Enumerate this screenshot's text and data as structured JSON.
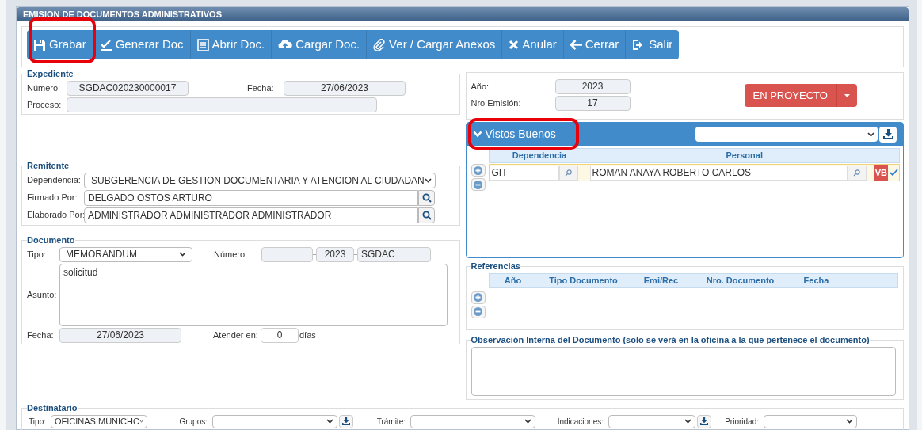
{
  "panel_title": "EMISION DE DOCUMENTOS ADMINISTRATIVOS",
  "toolbar": [
    {
      "label": "Grabar",
      "highlighted": true
    },
    {
      "label": "Generar Doc",
      "highlighted": false
    },
    {
      "label": "Abrir Doc.",
      "highlighted": false
    },
    {
      "label": "Cargar Doc.",
      "highlighted": false
    },
    {
      "label": "Ver / Cargar Anexos",
      "highlighted": false
    },
    {
      "label": "Anular",
      "highlighted": false
    },
    {
      "label": "Cerrar",
      "highlighted": false
    },
    {
      "label": "Salir",
      "highlighted": false
    }
  ],
  "expediente": {
    "legend": "Expediente",
    "numero_label": "Número:",
    "numero": "SGDAC020230000017",
    "fecha_label": "Fecha:",
    "fecha": "27/06/2023",
    "proceso_label": "Proceso:"
  },
  "emision": {
    "anio_label": "Año:",
    "anio": "2023",
    "nro_label": "Nro Emisión:",
    "nro": "17",
    "status": "EN PROYECTO"
  },
  "vistos_buenos": {
    "title": "Vistos Buenos",
    "highlighted": true,
    "columns": [
      "Dependencia",
      "Personal"
    ],
    "rows": [
      {
        "dependencia": "GIT",
        "personal": "ROMAN ANAYA ROBERTO CARLOS",
        "badge": "VB",
        "checked": true
      }
    ]
  },
  "remitente": {
    "legend": "Remitente",
    "fields": [
      {
        "label": "Dependencia:",
        "value": "SUBGERENCIA DE GESTION DOCUMENTARIA Y ATENCION AL CIUDADAN",
        "kind": "select"
      },
      {
        "label": "Firmado Por:",
        "value": "DELGADO OSTOS ARTURO",
        "kind": "search"
      },
      {
        "label": "Elaborado Por:",
        "value": "ADMINISTRADOR ADMINISTRADOR ADMINISTRADOR",
        "kind": "search"
      }
    ]
  },
  "documento": {
    "legend": "Documento",
    "tipo_label": "Tipo:",
    "tipo": "MEMORANDUM",
    "numero_label": "Número:",
    "numero_year": "2023",
    "numero_suffix": "SGDAC",
    "asunto_label": "Asunto:",
    "asunto": "solicitud",
    "fecha_label": "Fecha:",
    "fecha": "27/06/2023",
    "atender_label": "Atender en:",
    "atender": "0",
    "atender_unit": "días"
  },
  "referencias": {
    "legend": "Referencias",
    "columns": [
      "Año",
      "Tipo Documento",
      "Emi/Rec",
      "Nro. Documento",
      "Fecha"
    ]
  },
  "observacion": {
    "legend": "Observación Interna del Documento (solo se verá en la oficina a la que pertenece el documento)"
  },
  "destinatario": {
    "legend": "Destinatario",
    "fields": [
      {
        "label": "Tipo:",
        "value": "OFICINAS MUNICHC",
        "kind": "select"
      },
      {
        "label": "Grupos:",
        "kind": "select_download"
      },
      {
        "label": "Trámite:",
        "kind": "select"
      },
      {
        "label": "Indicaciones:",
        "kind": "select_download"
      },
      {
        "label": "Prioridad:",
        "kind": "select"
      }
    ]
  }
}
